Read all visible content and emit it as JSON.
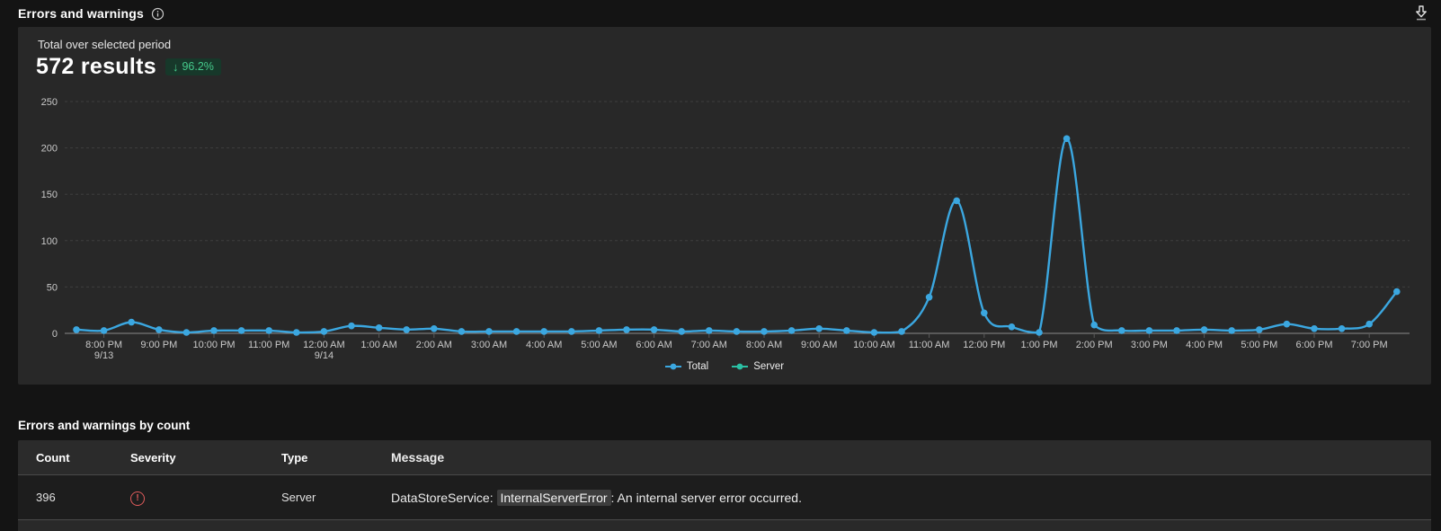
{
  "header": {
    "title": "Errors and warnings"
  },
  "summary": {
    "label": "Total over selected period",
    "value": "572 results",
    "delta": "96.2%",
    "delta_direction": "down",
    "delta_arrow": "↓"
  },
  "colors": {
    "accent_blue": "#3ba7e0",
    "accent_teal": "#2bc0a4",
    "delta_green": "#46cb8c",
    "error_red": "#e05b5b",
    "grid_line": "#3e3e3e",
    "axis_line": "#8a8a8a"
  },
  "chart_data": {
    "type": "line",
    "interval_minutes": 30,
    "first_point_time": "7:30 PM",
    "ylim": [
      0,
      250
    ],
    "yticks": [
      0,
      50,
      100,
      150,
      200,
      250
    ],
    "grid": "dashed-horizontal",
    "legend_position": "bottom-center",
    "hour_labels": [
      "8:00 PM",
      "9:00 PM",
      "10:00 PM",
      "11:00 PM",
      "12:00 AM",
      "1:00 AM",
      "2:00 AM",
      "3:00 AM",
      "4:00 AM",
      "5:00 AM",
      "6:00 AM",
      "7:00 AM",
      "8:00 AM",
      "9:00 AM",
      "10:00 AM",
      "11:00 AM",
      "12:00 PM",
      "1:00 PM",
      "2:00 PM",
      "3:00 PM",
      "4:00 PM",
      "5:00 PM",
      "6:00 PM",
      "7:00 PM"
    ],
    "date_labels": [
      {
        "hour_index": 0,
        "text": "9/13"
      },
      {
        "hour_index": 4,
        "text": "9/14"
      }
    ],
    "series": [
      {
        "name": "Total",
        "color": "#3ba7e0",
        "values": [
          4,
          3,
          12,
          4,
          1,
          3,
          3,
          3,
          1,
          2,
          8,
          6,
          4,
          5,
          2,
          2,
          2,
          2,
          2,
          3,
          4,
          4,
          2,
          3,
          2,
          2,
          3,
          5,
          3,
          1,
          2,
          39,
          143,
          22,
          7,
          1,
          210,
          9,
          3,
          3,
          3,
          4,
          3,
          4,
          10,
          5,
          5,
          10,
          45
        ]
      },
      {
        "name": "Server",
        "color": "#2bc0a4",
        "values": [],
        "visible_as_distinct_line": false
      }
    ]
  },
  "table": {
    "heading": "Errors and warnings by count",
    "columns": [
      "Count",
      "Severity",
      "Type",
      "Message"
    ],
    "rows": [
      {
        "count": "396",
        "severity": "error",
        "type": "Server",
        "message_prefix": "DataStoreService: ",
        "message_highlight": "InternalServerError",
        "message_suffix": ": An internal server error occurred."
      }
    ]
  }
}
